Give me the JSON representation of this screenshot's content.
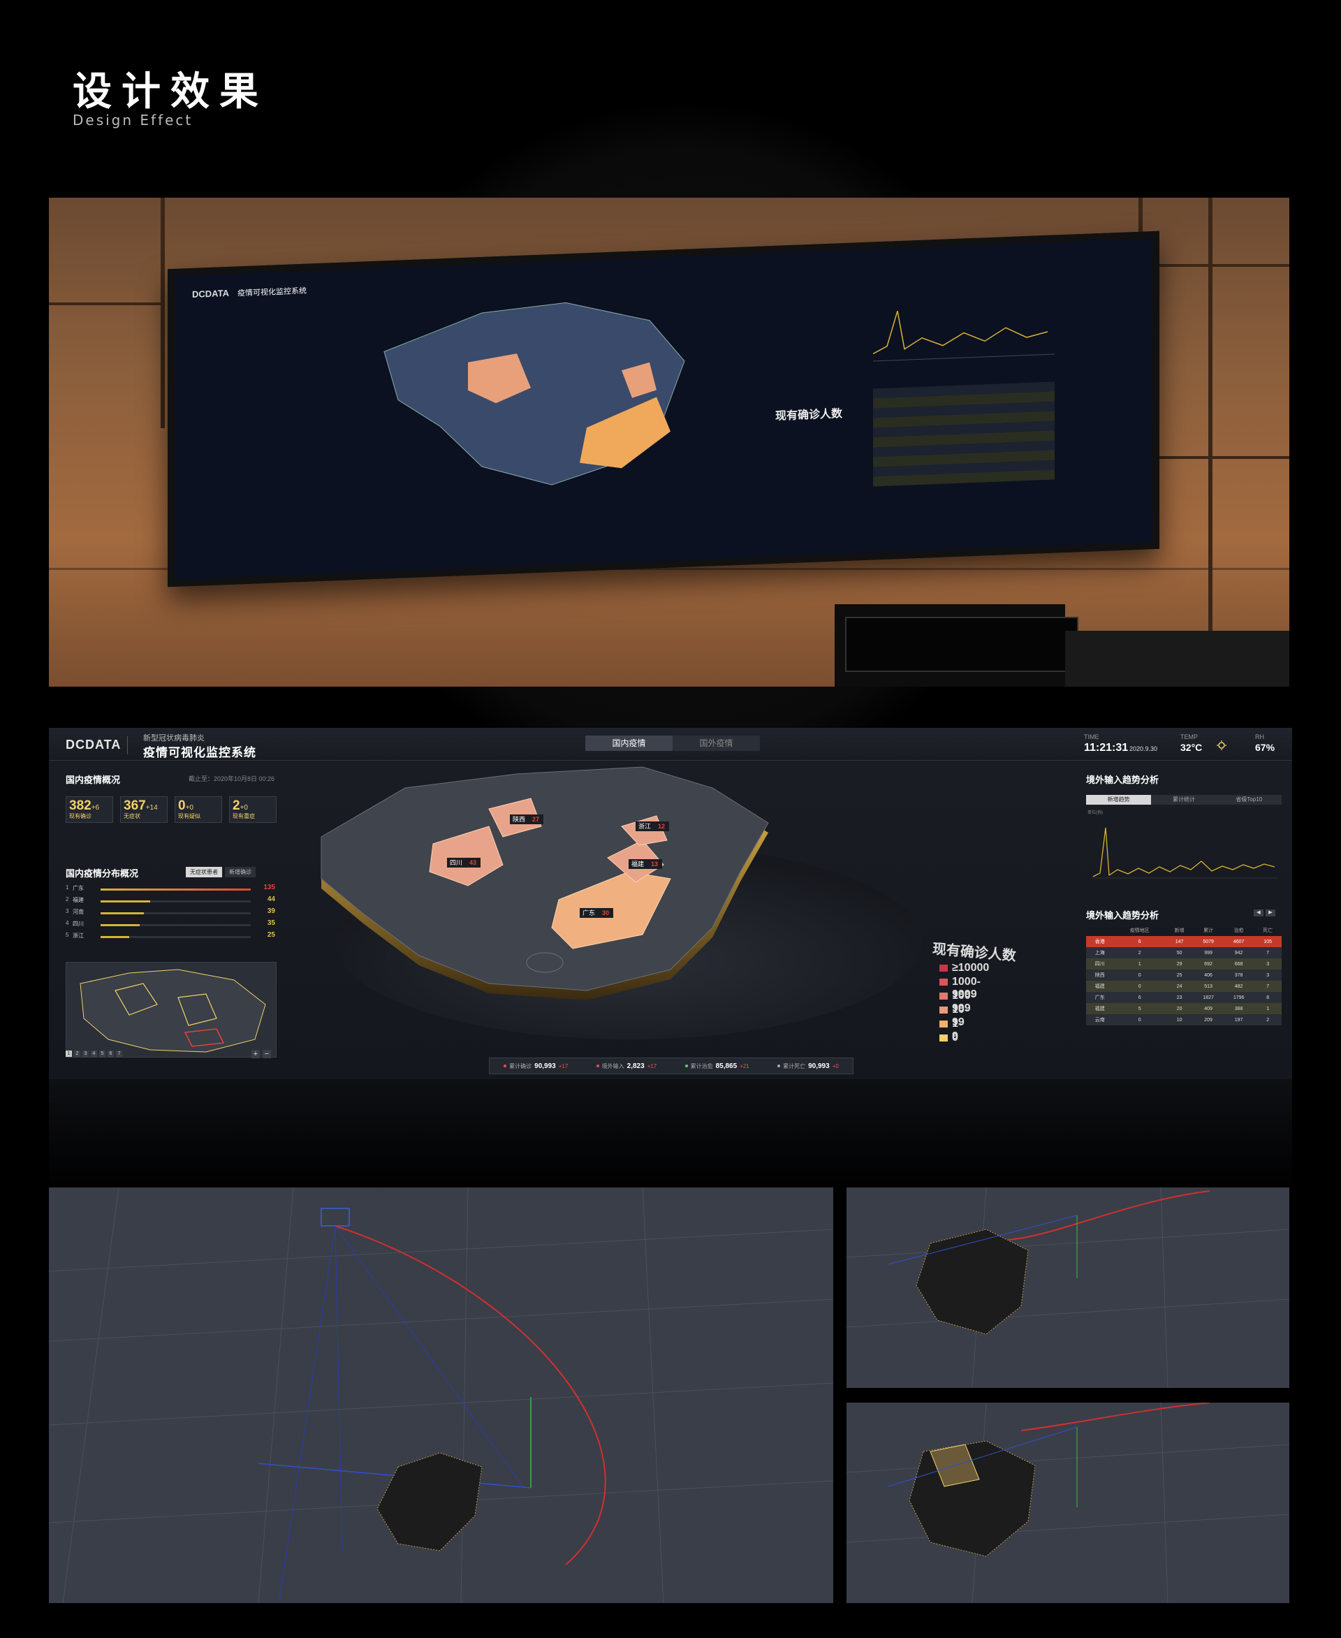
{
  "header": {
    "title": "设计效果",
    "subtitle": "Design Effect"
  },
  "dashboard": {
    "logo": "DCDATA",
    "system_sub": "新型冠状病毒肺炎",
    "system_title": "疫情可视化监控系统",
    "tabs": [
      {
        "label": "国内疫情"
      },
      {
        "label": "国外疫情"
      }
    ],
    "time_label": "TIME",
    "time": "11:21:31",
    "date": "2020.9.30",
    "temp_label": "TEMP",
    "temp": "32°C",
    "rh_label": "RH",
    "rh": "67%",
    "overview_title": "国内疫情概况",
    "asof": "截止至：2020年10月8日 00:26",
    "stats": [
      {
        "num": "382",
        "inc": "+6",
        "label": "现有确诊"
      },
      {
        "num": "367",
        "inc": "+14",
        "label": "无症状"
      },
      {
        "num": "0",
        "inc": "+0",
        "label": "现有疑似"
      },
      {
        "num": "2",
        "inc": "+0",
        "label": "现有重症"
      }
    ],
    "dist_title": "国内疫情分布概况",
    "dist_tabs": [
      "无症状患者",
      "新增确诊"
    ],
    "dist_rows": [
      {
        "idx": "1",
        "name": "广东",
        "value": "135",
        "ratio": 1.0
      },
      {
        "idx": "2",
        "name": "福建",
        "value": "44",
        "ratio": 0.33
      },
      {
        "idx": "3",
        "name": "河南",
        "value": "39",
        "ratio": 0.29
      },
      {
        "idx": "4",
        "name": "四川",
        "value": "35",
        "ratio": 0.26
      },
      {
        "idx": "5",
        "name": "浙江",
        "value": "25",
        "ratio": 0.19
      }
    ],
    "pager": [
      "1",
      "2",
      "3",
      "4",
      "5",
      "6",
      "7"
    ],
    "zoom": [
      "+",
      "−"
    ],
    "map_labels": [
      {
        "name": "陕西",
        "value": "27"
      },
      {
        "name": "四川",
        "value": "43"
      },
      {
        "name": "浙江",
        "value": "12"
      },
      {
        "name": "福建",
        "value": "13"
      },
      {
        "name": "广东",
        "value": "30"
      }
    ],
    "legend_title": "现有确诊人数",
    "legend": [
      {
        "label": "≥10000",
        "color": "#c5384a"
      },
      {
        "label": "1000-9999",
        "color": "#d9555e"
      },
      {
        "label": "100-999",
        "color": "#e07a6e"
      },
      {
        "label": "10-99",
        "color": "#e89a7c"
      },
      {
        "label": "1-9",
        "color": "#f0b36a"
      },
      {
        "label": "0",
        "color": "#f2d16b"
      }
    ],
    "bottom": [
      {
        "label": "累计确诊",
        "value": "90,993",
        "delta": "+17",
        "color": "#e55050"
      },
      {
        "label": "境外输入",
        "value": "2,823",
        "delta": "+17",
        "color": "#e55050"
      },
      {
        "label": "累计治愈",
        "value": "85,865",
        "delta": "+21",
        "color": "#5fd26a"
      },
      {
        "label": "累计死亡",
        "value": "90,993",
        "delta": "+0",
        "color": "#aaaaaa"
      }
    ],
    "trend_title": "境外输入趋势分析",
    "trend_tabs": [
      "新增趋势",
      "累计统计",
      "省级Top10"
    ],
    "trend_unit": "单位(例)",
    "table_title": "境外输入趋势分析",
    "table_headers": [
      "疫情地区",
      "新增",
      "累计",
      "治愈",
      "死亡"
    ],
    "table_rows": [
      [
        "香港",
        "6",
        "147",
        "5079",
        "4607",
        "105"
      ],
      [
        "上海",
        "2",
        "50",
        "999",
        "942",
        "7"
      ],
      [
        "四川",
        "1",
        "29",
        "692",
        "668",
        "3"
      ],
      [
        "陕西",
        "0",
        "25",
        "406",
        "378",
        "3"
      ],
      [
        "福建",
        "0",
        "24",
        "513",
        "482",
        "7"
      ],
      [
        "广东",
        "6",
        "23",
        "1827",
        "1796",
        "8"
      ],
      [
        "福建",
        "5",
        "20",
        "409",
        "388",
        "1"
      ],
      [
        "云南",
        "0",
        "10",
        "209",
        "197",
        "2"
      ]
    ]
  },
  "photo": {
    "screen_logo": "DCDATA",
    "screen_title": "疫情可视化监控系统",
    "screen_legend_title": "现有确诊人数"
  }
}
